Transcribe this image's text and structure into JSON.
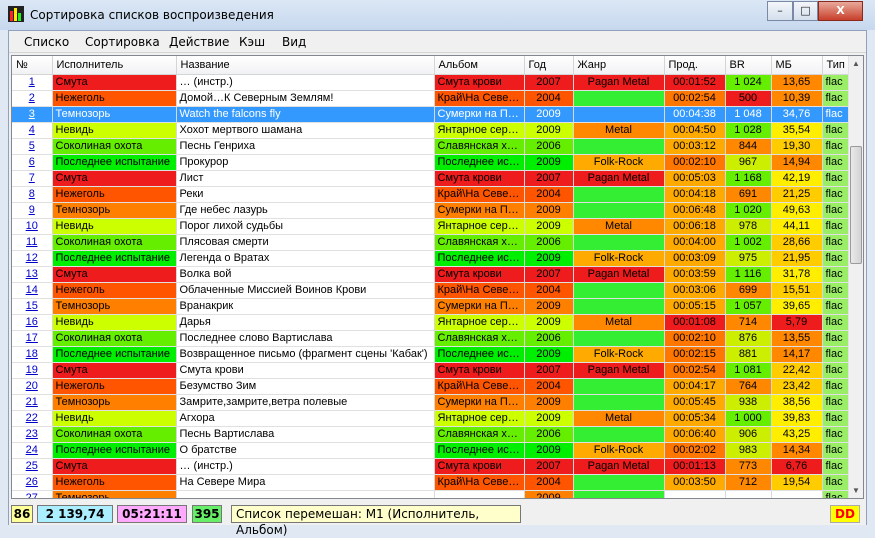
{
  "window": {
    "title": "Сортировка списков воспроизведения",
    "buttons": {
      "minimize": "–",
      "maximize": "□",
      "close": "X"
    }
  },
  "menu": [
    "Списко",
    "Сортировка",
    "Действие",
    "Кэш",
    "Вид"
  ],
  "columns": [
    "№",
    "Исполнитель",
    "Название",
    "Альбом",
    "Год",
    "Жанр",
    "Прод.",
    "BR",
    "МБ",
    "Тип"
  ],
  "colors": {
    "red": "#ee1c1c",
    "orange": "#ff7f00",
    "yellow": "#ccff00",
    "green": "#00ee00",
    "lime": "#7fff00",
    "darkorange": "#ff5a00",
    "genre_pagan": "#ee1c1c",
    "genre_metal": "#ff8800",
    "genre_folk": "#ffaa00",
    "genre_none": "#33ee33",
    "type_flac": "#99ee66",
    "mb_yellow": "#ffee00"
  },
  "artist_colors": {
    "Смута": "#ee1c1c",
    "Нежеголь": "#ff5500",
    "Темнозорь": "#ff7f00",
    "Невидь": "#ccff00",
    "Соколиная охота": "#66ee00",
    "Последнее испытание": "#00ee00"
  },
  "rows": [
    {
      "n": "1",
      "artist": "Смута",
      "title": "… (инстр.)",
      "album": "Смута крови",
      "year": "2007",
      "genre": "Pagan Metal",
      "dur": "00:01:52",
      "br": "1 024",
      "mb": "13,65",
      "type": "flac"
    },
    {
      "n": "2",
      "artist": "Нежеголь",
      "title": "Домой…К Северным Землям!",
      "album": "Край\\На Север…",
      "year": "2004",
      "genre": "",
      "dur": "00:02:54",
      "br": "500",
      "mb": "10,39",
      "type": "flac"
    },
    {
      "n": "3",
      "artist": "Темнозорь",
      "title": "Watch the falcons fly",
      "album": "Сумерки на П…",
      "year": "2009",
      "genre": "",
      "dur": "00:04:38",
      "br": "1 048",
      "mb": "34,76",
      "type": "flac",
      "selected": true
    },
    {
      "n": "4",
      "artist": "Невидь",
      "title": "Хохот мертвого шамана",
      "album": "Янтарное сер…",
      "year": "2009",
      "genre": "Metal",
      "dur": "00:04:50",
      "br": "1 028",
      "mb": "35,54",
      "type": "flac"
    },
    {
      "n": "5",
      "artist": "Соколиная охота",
      "title": "Песнь Генриха",
      "album": "Славянская х…",
      "year": "2006",
      "genre": "",
      "dur": "00:03:12",
      "br": "844",
      "mb": "19,30",
      "type": "flac"
    },
    {
      "n": "6",
      "artist": "Последнее испытание",
      "title": "Прокурор",
      "album": "Последнее ис…",
      "year": "2009",
      "genre": "Folk-Rock",
      "dur": "00:02:10",
      "br": "967",
      "mb": "14,94",
      "type": "flac"
    },
    {
      "n": "7",
      "artist": "Смута",
      "title": "Лист",
      "album": "Смута крови",
      "year": "2007",
      "genre": "Pagan Metal",
      "dur": "00:05:03",
      "br": "1 168",
      "mb": "42,19",
      "type": "flac"
    },
    {
      "n": "8",
      "artist": "Нежеголь",
      "title": "Реки",
      "album": "Край\\На Север…",
      "year": "2004",
      "genre": "",
      "dur": "00:04:18",
      "br": "691",
      "mb": "21,25",
      "type": "flac"
    },
    {
      "n": "9",
      "artist": "Темнозорь",
      "title": "Где небес лазурь",
      "album": "Сумерки на П…",
      "year": "2009",
      "genre": "",
      "dur": "00:06:48",
      "br": "1 020",
      "mb": "49,63",
      "type": "flac"
    },
    {
      "n": "10",
      "artist": "Невидь",
      "title": "Порог лихой судьбы",
      "album": "Янтарное сер…",
      "year": "2009",
      "genre": "Metal",
      "dur": "00:06:18",
      "br": "978",
      "mb": "44,11",
      "type": "flac"
    },
    {
      "n": "11",
      "artist": "Соколиная охота",
      "title": "Плясовая смерти",
      "album": "Славянская х…",
      "year": "2006",
      "genre": "",
      "dur": "00:04:00",
      "br": "1 002",
      "mb": "28,66",
      "type": "flac"
    },
    {
      "n": "12",
      "artist": "Последнее испытание",
      "title": "Легенда о Вратах",
      "album": "Последнее ис…",
      "year": "2009",
      "genre": "Folk-Rock",
      "dur": "00:03:09",
      "br": "975",
      "mb": "21,95",
      "type": "flac"
    },
    {
      "n": "13",
      "artist": "Смута",
      "title": "Волка вой",
      "album": "Смута крови",
      "year": "2007",
      "genre": "Pagan Metal",
      "dur": "00:03:59",
      "br": "1 116",
      "mb": "31,78",
      "type": "flac"
    },
    {
      "n": "14",
      "artist": "Нежеголь",
      "title": "Облаченные Миссией Воинов Крови",
      "album": "Край\\На Север…",
      "year": "2004",
      "genre": "",
      "dur": "00:03:06",
      "br": "699",
      "mb": "15,51",
      "type": "flac"
    },
    {
      "n": "15",
      "artist": "Темнозорь",
      "title": "Вранакрик",
      "album": "Сумерки на П…",
      "year": "2009",
      "genre": "",
      "dur": "00:05:15",
      "br": "1 057",
      "mb": "39,65",
      "type": "flac"
    },
    {
      "n": "16",
      "artist": "Невидь",
      "title": "Дарья",
      "album": "Янтарное сер…",
      "year": "2009",
      "genre": "Metal",
      "dur": "00:01:08",
      "br": "714",
      "mb": "5,79",
      "type": "flac"
    },
    {
      "n": "17",
      "artist": "Соколиная охота",
      "title": "Последнее слово Вартислава",
      "album": "Славянская х…",
      "year": "2006",
      "genre": "",
      "dur": "00:02:10",
      "br": "876",
      "mb": "13,55",
      "type": "flac"
    },
    {
      "n": "18",
      "artist": "Последнее испытание",
      "title": "Возвращенное письмо (фрагмент сцены 'Кабак')",
      "album": "Последнее ис…",
      "year": "2009",
      "genre": "Folk-Rock",
      "dur": "00:02:15",
      "br": "881",
      "mb": "14,17",
      "type": "flac"
    },
    {
      "n": "19",
      "artist": "Смута",
      "title": "Смута крови",
      "album": "Смута крови",
      "year": "2007",
      "genre": "Pagan Metal",
      "dur": "00:02:54",
      "br": "1 081",
      "mb": "22,42",
      "type": "flac"
    },
    {
      "n": "20",
      "artist": "Нежеголь",
      "title": "Безумство Зим",
      "album": "Край\\На Север…",
      "year": "2004",
      "genre": "",
      "dur": "00:04:17",
      "br": "764",
      "mb": "23,42",
      "type": "flac"
    },
    {
      "n": "21",
      "artist": "Темнозорь",
      "title": "Замрите,замрите,ветра полевые",
      "album": "Сумерки на П…",
      "year": "2009",
      "genre": "",
      "dur": "00:05:45",
      "br": "938",
      "mb": "38,56",
      "type": "flac"
    },
    {
      "n": "22",
      "artist": "Невидь",
      "title": "Агхора",
      "album": "Янтарное сер…",
      "year": "2009",
      "genre": "Metal",
      "dur": "00:05:34",
      "br": "1 000",
      "mb": "39,83",
      "type": "flac"
    },
    {
      "n": "23",
      "artist": "Соколиная охота",
      "title": "Песнь Вартислава",
      "album": "Славянская х…",
      "year": "2006",
      "genre": "",
      "dur": "00:06:40",
      "br": "906",
      "mb": "43,25",
      "type": "flac"
    },
    {
      "n": "24",
      "artist": "Последнее испытание",
      "title": "О братстве",
      "album": "Последнее ис…",
      "year": "2009",
      "genre": "Folk-Rock",
      "dur": "00:02:02",
      "br": "983",
      "mb": "14,34",
      "type": "flac"
    },
    {
      "n": "25",
      "artist": "Смута",
      "title": "… (инстр.)",
      "album": "Смута крови",
      "year": "2007",
      "genre": "Pagan Metal",
      "dur": "00:01:13",
      "br": "773",
      "mb": "6,76",
      "type": "flac"
    },
    {
      "n": "26",
      "artist": "Нежеголь",
      "title": "На Севере Мира",
      "album": "Край\\На Север…",
      "year": "2004",
      "genre": "",
      "dur": "00:03:50",
      "br": "712",
      "mb": "19,54",
      "type": "flac"
    },
    {
      "n": "27",
      "artist": "Темнозорь",
      "title": "",
      "album": "",
      "year": "2009",
      "genre": "",
      "dur": "",
      "br": "",
      "mb": "",
      "type": "flac"
    }
  ],
  "status": {
    "count": "86",
    "size": "2 139,74",
    "duration": "05:21:11",
    "files": "395",
    "message": "Список перемешан: M1 (Исполнитель, Альбом)",
    "badge": "DD"
  }
}
